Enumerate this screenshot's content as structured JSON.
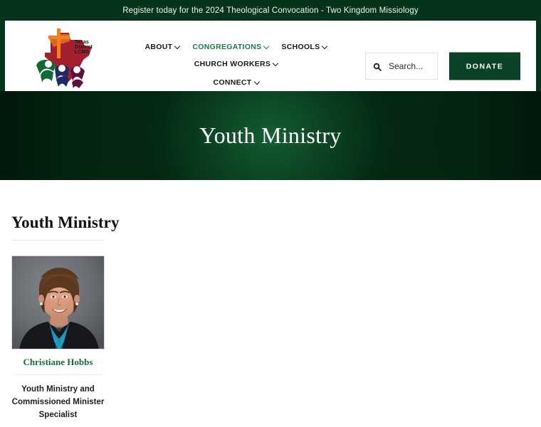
{
  "announcement": {
    "text": "Register today for the 2024 Theological Convocation - Two Kingdom Missiology"
  },
  "header": {
    "logo_alt": "Texas District LCMS",
    "logo_text_line1": "Texas",
    "logo_text_line2": "District",
    "logo_text_line3": "LCMS",
    "nav_row1": [
      {
        "label": "ABOUT",
        "active": false
      },
      {
        "label": "CONGREGATIONS",
        "active": true
      },
      {
        "label": "SCHOOLS",
        "active": false
      },
      {
        "label": "CHURCH WORKERS",
        "active": false
      }
    ],
    "nav_row2": [
      {
        "label": "CONNECT",
        "active": false
      }
    ],
    "search": {
      "placeholder": "Search...",
      "value": ""
    },
    "donate_label": "DONATE"
  },
  "hero": {
    "title": "Youth Ministry"
  },
  "main": {
    "page_title": "Youth Ministry",
    "people": [
      {
        "name": "Christiane Hobbs",
        "role": "Youth Ministry and Commissioned Minister Specialist"
      }
    ]
  },
  "colors": {
    "brand_green": "#1a7a4a",
    "dark_green": "#04351c",
    "donate_green": "#0a4228",
    "name_green": "#1a6b3a"
  }
}
